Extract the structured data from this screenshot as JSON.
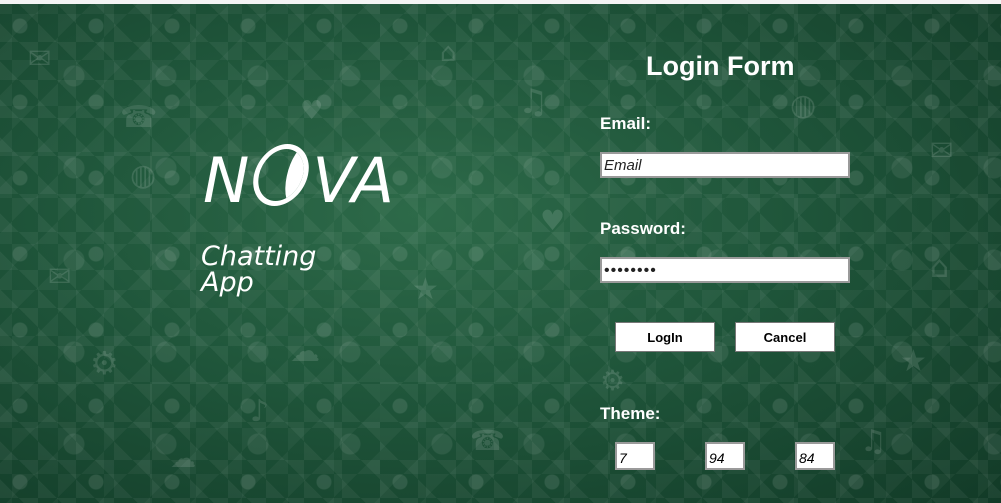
{
  "app": {
    "brand": "NOVA",
    "brand_left": "N",
    "brand_right": "VA",
    "tagline_line1": "Chatting",
    "tagline_line2": "App"
  },
  "form": {
    "title": "Login Form",
    "email_label": "Email:",
    "email_value": "Email",
    "password_label": "Password:",
    "password_value": "••••••••",
    "login_button": "LogIn",
    "cancel_button": "Cancel",
    "theme_label": "Theme:",
    "theme_values": [
      "7",
      "94",
      "84"
    ]
  },
  "colors": {
    "background_green": "#1f553a",
    "text": "#ffffff"
  },
  "icons": [
    "chat-icon",
    "phone-icon",
    "camera-icon",
    "home-icon",
    "mail-icon",
    "globe-icon",
    "heart-icon",
    "music-icon"
  ]
}
